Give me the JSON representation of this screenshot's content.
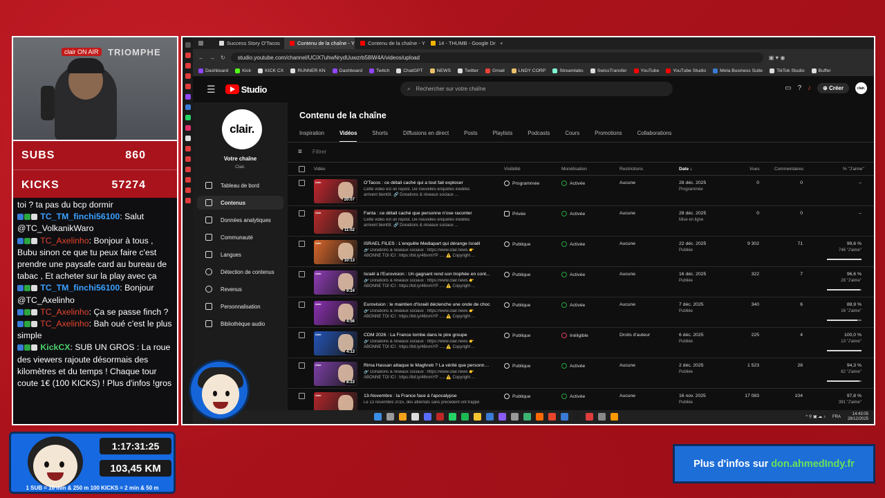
{
  "overlay": {
    "cam_sign": "TRIOMPHE",
    "cam_onair": "clair ON AIR",
    "subs_label": "SUBS",
    "subs_value": "860",
    "kicks_label": "KICKS",
    "kicks_value": "57274",
    "timer": "1:17:31:25",
    "distance": "103,45 KM",
    "rules": "1 SUB = 10 min & 250 m     100 KICKS = 2 min & 50 m",
    "infos_prefix": "Plus d'infos sur",
    "infos_link": "don.ahmedIndy.fr"
  },
  "chat": [
    {
      "user": "",
      "text": "toi ? ta pas du bcp dormir"
    },
    {
      "user": "TC_TM_finchi56100",
      "text": ": Salut @TC_VolkanikWaro"
    },
    {
      "user": "TC_Axelinho",
      "text": ": Bonjour à tous , Bubu sinon ce que tu peux faire c'est prendre une paysafe card au bureau de tabac , Et acheter sur la play avec ça"
    },
    {
      "user": "TC_TM_finchi56100",
      "text": ": Bonjour @TC_Axelinho"
    },
    {
      "user": "TC_Axelinho",
      "text": ": Ça se passe finch ?"
    },
    {
      "user": "TC_Axelinho",
      "text": ": Bah oué c'est le plus simple"
    },
    {
      "user": "KickCX",
      "text": ": SUB UN GROS : La roue des viewers rajoute désormais des kilomètres et du temps ! Chaque tour coute 1€ (100 KICKS) ! Plus d'infos !gros"
    }
  ],
  "browser": {
    "tabs": [
      "Success Story O'Tacos",
      "Contenu de la chaîne - Y",
      "Contenu de la chaîne - Y",
      "14 - THUMB - Google Dri"
    ],
    "url": "studio.youtube.com/channel/UCiX7uhwNrydUuwzrb58iW4A/videos/upload",
    "bookmarks": [
      "Dashboard",
      "Kick",
      "KICK CX",
      "RUNNER KN",
      "Dashboard",
      "Twitch",
      "ChatGPT",
      "NEWS",
      "Twitter",
      "Gmail",
      "LNDY CORP",
      "Streamlabs",
      "SwissTransfer",
      "YouTube",
      "YouTube Studio",
      "Meta Business Suite",
      "TikTok Studio",
      "Buffer"
    ]
  },
  "studio": {
    "logo": "Studio",
    "search_placeholder": "Rechercher sur votre chaîne",
    "create_label": "Créer",
    "channel_logo": "clair.",
    "channel_name": "Votre chaîne",
    "channel_sub": "Clair.",
    "nav": [
      "Tableau de bord",
      "Contenus",
      "Données analytiques",
      "Communauté",
      "Langues",
      "Détection de contenus",
      "Revenus",
      "Personnalisation",
      "Bibliothèque audio"
    ],
    "page_title": "Contenu de la chaîne",
    "tabs": [
      "Inspiration",
      "Vidéos",
      "Shorts",
      "Diffusions en direct",
      "Posts",
      "Playlists",
      "Podcasts",
      "Cours",
      "Promotions",
      "Collaborations"
    ],
    "filter_placeholder": "Filtrer",
    "columns": {
      "video": "Vidéo",
      "visibility": "Visibilité",
      "monetization": "Monétisation",
      "restrictions": "Restrictions",
      "date": "Date",
      "views": "Vues",
      "comments": "Commentaires",
      "likes": "% \"J'aime\""
    },
    "rows": [
      {
        "title": "O'Tacos : ce détail caché qui a tout fait exploser",
        "desc1": "Cette vidéo est un repost. De nouvelles enquêtes inédites",
        "desc2": "arrivent bientôt. 🔗 Donations & réseaux sociaux ...",
        "dur": "20:07",
        "vis": "Programmée",
        "mon": "Activée",
        "res": "Aucune",
        "date": "28 déc. 2025",
        "dsub": "Programmée",
        "views": "0",
        "comments": "0",
        "likes": "–",
        "likes_sub": "",
        "fill": 0,
        "color": "#c4262e"
      },
      {
        "title": "Fanta : ce détail caché que personne n'ose raconter",
        "desc1": "Cette vidéo est un repost. De nouvelles enquêtes inédites",
        "desc2": "arrivent bientôt. 🔗 Donations & réseaux sociaux ...",
        "dur": "11:02",
        "vis": "Privée",
        "mon": "Activée",
        "res": "Aucune",
        "date": "28 déc. 2025",
        "dsub": "Mise en ligne",
        "views": "0",
        "comments": "0",
        "likes": "–",
        "likes_sub": "",
        "fill": 0,
        "color": "#b82a2a"
      },
      {
        "title": "ISRAEL FILES : L'enquête Mediapart qui dérange Israël",
        "desc1": "🔗 Donations & réseaux sociaux : https://www.clair.news 👉",
        "desc2": "ABONNE TOI ICI : https://bit.ly/46rvmYP ..... ⚠️ Copyright ...",
        "dur": "10:13",
        "vis": "Publique",
        "mon": "Activée",
        "res": "Aucune",
        "date": "22 déc. 2025",
        "dsub": "Publiée",
        "views": "9 302",
        "comments": "71",
        "likes": "99,6 %",
        "likes_sub": "746 \"J'aime\"",
        "fill": 0.996,
        "color": "#d9662a"
      },
      {
        "title": "Israël à l'Eurovision : Un gagnant rend son trophée en cont...",
        "desc1": "🔗 Donations & réseaux sociaux : https://www.clair.news 👉",
        "desc2": "ABONNE TOI ICI : https://bit.ly/46rvmYP ..... ⚠️ Copyright ...",
        "dur": "9:24",
        "vis": "Publique",
        "mon": "Activée",
        "res": "Aucune",
        "date": "16 déc. 2025",
        "dsub": "Publiée",
        "views": "322",
        "comments": "7",
        "likes": "96,6 %",
        "likes_sub": "28 \"J'aime\"",
        "fill": 0.966,
        "color": "#8e3bb5"
      },
      {
        "title": "Eurovision : le maintien d'Israël déclenche une onde de choc",
        "desc1": "🔗 Donations & réseaux sociaux : https://www.clair.news 👉",
        "desc2": "ABONNE TOI ICI : https://bit.ly/46rvmYP ..... ⚠️ Copyright ...",
        "dur": "4:56",
        "vis": "Publique",
        "mon": "Activée",
        "res": "Aucune",
        "date": "7 déc. 2025",
        "dsub": "Publiée",
        "views": "340",
        "comments": "6",
        "likes": "88,9 %",
        "likes_sub": "16 \"J'aime\"",
        "fill": 0.889,
        "color": "#8a2fb0"
      },
      {
        "title": "CDM 2026 : La France tombe dans le pire groupe",
        "desc1": "🔗 Donations & réseaux sociaux : https://www.clair.news 👉",
        "desc2": "ABONNE TOI ICI : https://bit.ly/46rvmYP ..... ⚠️ Copyright ...",
        "dur": "4:13",
        "vis": "Publique",
        "mon": "Inéligible",
        "res": "Droits d'auteur",
        "date": "6 déc. 2025",
        "dsub": "Publiée",
        "views": "225",
        "comments": "4",
        "likes": "100,0 %",
        "likes_sub": "13 \"J'aime\"",
        "fill": 1.0,
        "color": "#2354b8"
      },
      {
        "title": "Rima Hassan attaque le Maghreb ? La vérité que personne ...",
        "desc1": "🔗 Donations & réseaux sociaux : https://www.clair.news 👉",
        "desc2": "ABONNE TOI ICI : https://bit.ly/46rvmYP ..... ⚠️ Copyright ...",
        "dur": "8:23",
        "vis": "Publique",
        "mon": "Activée",
        "res": "Aucune",
        "date": "2 déc. 2025",
        "dsub": "Publiée",
        "views": "1 523",
        "comments": "28",
        "likes": "94,3 %",
        "likes_sub": "82 \"J'aime\"",
        "fill": 0.943,
        "color": "#7d3fa8"
      },
      {
        "title": "13-Novembre : la France face à l'apocalypse",
        "desc1": "Le 13 novembre 2015, des attentats sans précédent ont frappé",
        "desc2": "",
        "dur": "",
        "vis": "Publique",
        "mon": "Activée",
        "res": "Aucune",
        "date": "16 nov. 2025",
        "dsub": "Publiée",
        "views": "17 083",
        "comments": "104",
        "likes": "97,8 %",
        "likes_sub": "391 \"J'aime\"",
        "fill": 0.978,
        "color": "#b3262a"
      }
    ]
  },
  "taskbar": {
    "lang": "FRA",
    "time": "14:43:05",
    "date": "28/12/2025"
  }
}
